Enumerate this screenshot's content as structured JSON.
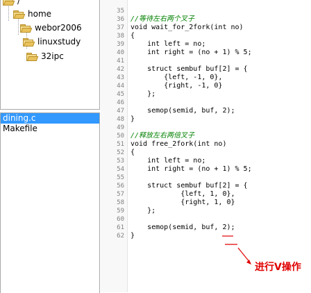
{
  "tree": {
    "root_label": "/",
    "items": [
      {
        "label": "home"
      },
      {
        "label": "webor2006"
      },
      {
        "label": "linuxstudy"
      },
      {
        "label": "32ipc"
      }
    ]
  },
  "files": [
    {
      "name": "dining.c",
      "selected": true
    },
    {
      "name": "Makefile",
      "selected": false
    }
  ],
  "code": {
    "lines": [
      {
        "n": "35",
        "text": "",
        "cls": ""
      },
      {
        "n": "36",
        "text": "//等待左右两个叉子",
        "cls": "comment"
      },
      {
        "n": "37",
        "text": "void wait_for_2fork(int no)",
        "cls": ""
      },
      {
        "n": "38",
        "text": "{",
        "cls": ""
      },
      {
        "n": "39",
        "text": "    int left = no;",
        "cls": ""
      },
      {
        "n": "40",
        "text": "    int right = (no + 1) % 5;",
        "cls": ""
      },
      {
        "n": "41",
        "text": "",
        "cls": ""
      },
      {
        "n": "42",
        "text": "    struct sembuf buf[2] = {",
        "cls": ""
      },
      {
        "n": "43",
        "text": "        {left, -1, 0},",
        "cls": ""
      },
      {
        "n": "44",
        "text": "        {right, -1, 0}",
        "cls": ""
      },
      {
        "n": "45",
        "text": "    };",
        "cls": ""
      },
      {
        "n": "46",
        "text": "",
        "cls": ""
      },
      {
        "n": "47",
        "text": "    semop(semid, buf, 2);",
        "cls": ""
      },
      {
        "n": "48",
        "text": "}",
        "cls": ""
      },
      {
        "n": "49",
        "text": "",
        "cls": ""
      },
      {
        "n": "50",
        "text": "//释放左右两倍叉子",
        "cls": "comment"
      },
      {
        "n": "51",
        "text": "void free_2fork(int no)",
        "cls": ""
      },
      {
        "n": "52",
        "text": "{",
        "cls": ""
      },
      {
        "n": "53",
        "text": "    int left = no;",
        "cls": ""
      },
      {
        "n": "54",
        "text": "    int right = (no + 1) % 5;",
        "cls": ""
      },
      {
        "n": "55",
        "text": "",
        "cls": ""
      },
      {
        "n": "56",
        "text": "    struct sembuf buf[2] = {",
        "cls": ""
      },
      {
        "n": "57",
        "text": "            {left, 1, 0},",
        "cls": ""
      },
      {
        "n": "58",
        "text": "            {right, 1, 0}",
        "cls": ""
      },
      {
        "n": "59",
        "text": "    };",
        "cls": ""
      },
      {
        "n": "60",
        "text": "",
        "cls": ""
      },
      {
        "n": "61",
        "text": "    semop(semid, buf, 2);",
        "cls": ""
      },
      {
        "n": "62",
        "text": "}",
        "cls": ""
      }
    ]
  },
  "annotation": {
    "text": "进行V操作",
    "color": "#e00000"
  },
  "colors": {
    "selection": "#3399ff",
    "comment": "#008000",
    "folder": "#f3d37a"
  }
}
